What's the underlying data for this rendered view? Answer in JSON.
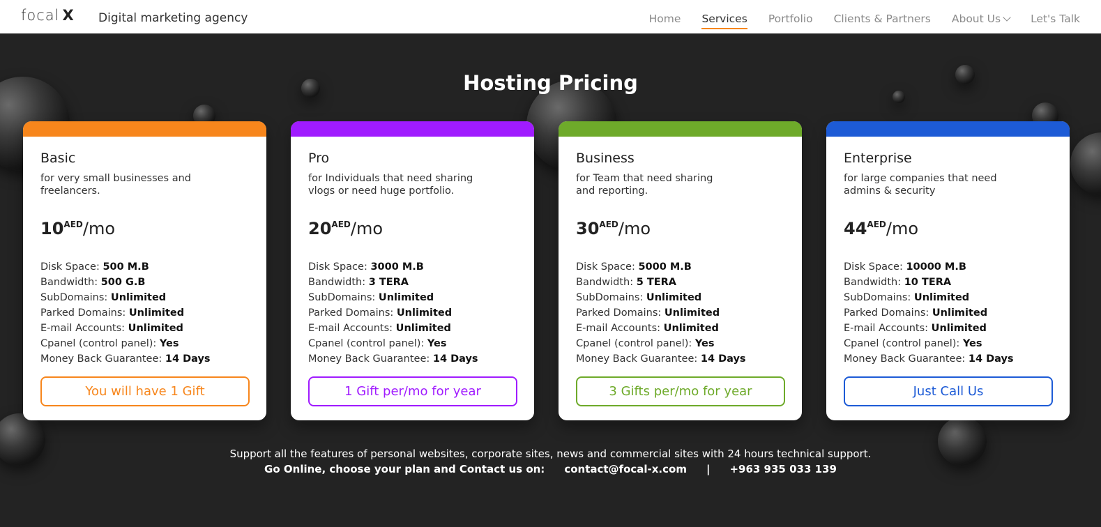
{
  "header": {
    "logo_text": "focal",
    "logo_x": "X",
    "tagline": "Digital marketing agency",
    "nav": [
      "Home",
      "Services",
      "Portfolio",
      "Clients & Partners",
      "About Us",
      "Let's Talk"
    ],
    "active_nav": "Services"
  },
  "page_title": "Hosting Pricing",
  "colors": {
    "basic": "#f7861c",
    "pro": "#a01bff",
    "business": "#6eaa2a",
    "enterprise": "#1d5bd6"
  },
  "plans": [
    {
      "name": "Basic",
      "description": "for very small businesses and freelancers.",
      "price": "10",
      "currency": "AED",
      "period": "/mo",
      "features": {
        "disk_space": "500 M.B",
        "bandwidth": "500 G.B",
        "subdomains": "Unlimited",
        "parked_domains": "Unlimited",
        "email_accounts": "Unlimited",
        "cpanel": "Yes",
        "money_back": "14 Days"
      },
      "button": "You will have 1 Gift"
    },
    {
      "name": "Pro",
      "description": "for Individuals that need sharing vlogs or need huge portfolio.",
      "price": "20",
      "currency": "AED",
      "period": "/mo",
      "features": {
        "disk_space": "3000 M.B",
        "bandwidth": "3 TERA",
        "subdomains": "Unlimited",
        "parked_domains": "Unlimited",
        "email_accounts": "Unlimited",
        "cpanel": "Yes",
        "money_back": "14 Days"
      },
      "button": "1 Gift per/mo for year"
    },
    {
      "name": "Business",
      "description": "for Team that need sharing and reporting.",
      "price": "30",
      "currency": "AED",
      "period": "/mo",
      "features": {
        "disk_space": "5000 M.B",
        "bandwidth": "5 TERA",
        "subdomains": "Unlimited",
        "parked_domains": "Unlimited",
        "email_accounts": "Unlimited",
        "cpanel": "Yes",
        "money_back": "14 Days"
      },
      "button": "3 Gifts per/mo for year"
    },
    {
      "name": "Enterprise",
      "description": "for large companies that need admins & security",
      "price": "44",
      "currency": "AED",
      "period": "/mo",
      "features": {
        "disk_space": "10000 M.B",
        "bandwidth": "10 TERA",
        "subdomains": "Unlimited",
        "parked_domains": "Unlimited",
        "email_accounts": "Unlimited",
        "cpanel": "Yes",
        "money_back": "14 Days"
      },
      "button": "Just Call Us"
    }
  ],
  "feature_labels": {
    "disk_space": "Disk Space: ",
    "bandwidth": "Bandwidth: ",
    "subdomains": "SubDomains: ",
    "parked_domains": "Parked Domains: ",
    "email_accounts": "E-mail Accounts: ",
    "cpanel": "Cpanel (control panel): ",
    "money_back": "Money Back Guarantee: "
  },
  "footer": {
    "support": "Support all the features of personal websites, corporate sites, news and commercial sites with 24 hours technical support.",
    "contact_prefix": "Go Online, choose your plan and Contact us on:",
    "email": "contact@focal-x.com",
    "separator": "|",
    "phone": "+963 935 033 139"
  }
}
